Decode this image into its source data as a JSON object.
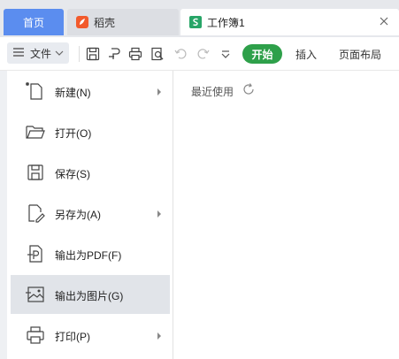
{
  "tabs": {
    "home": "首页",
    "daoke": "稻壳",
    "document": "工作簿1"
  },
  "toolbar": {
    "file_label": "文件",
    "ribbon_tabs": {
      "start": "开始",
      "insert": "插入",
      "page_layout": "页面布局"
    }
  },
  "file_menu": {
    "items": [
      {
        "label": "新建(N)",
        "icon": "new-file-icon",
        "has_submenu": true
      },
      {
        "label": "打开(O)",
        "icon": "open-folder-icon",
        "has_submenu": false
      },
      {
        "label": "保存(S)",
        "icon": "save-icon",
        "has_submenu": false
      },
      {
        "label": "另存为(A)",
        "icon": "save-as-icon",
        "has_submenu": true
      },
      {
        "label": "输出为PDF(F)",
        "icon": "export-pdf-icon",
        "has_submenu": false
      },
      {
        "label": "输出为图片(G)",
        "icon": "export-image-icon",
        "has_submenu": false
      },
      {
        "label": "打印(P)",
        "icon": "print-icon",
        "has_submenu": true
      }
    ]
  },
  "recent": {
    "title": "最近使用"
  },
  "colors": {
    "accent_blue": "#5b8def",
    "start_green": "#2ea04a",
    "daoke_orange": "#f25a2c",
    "sheet_green": "#27a567",
    "active_row": "#e1e4e9"
  }
}
